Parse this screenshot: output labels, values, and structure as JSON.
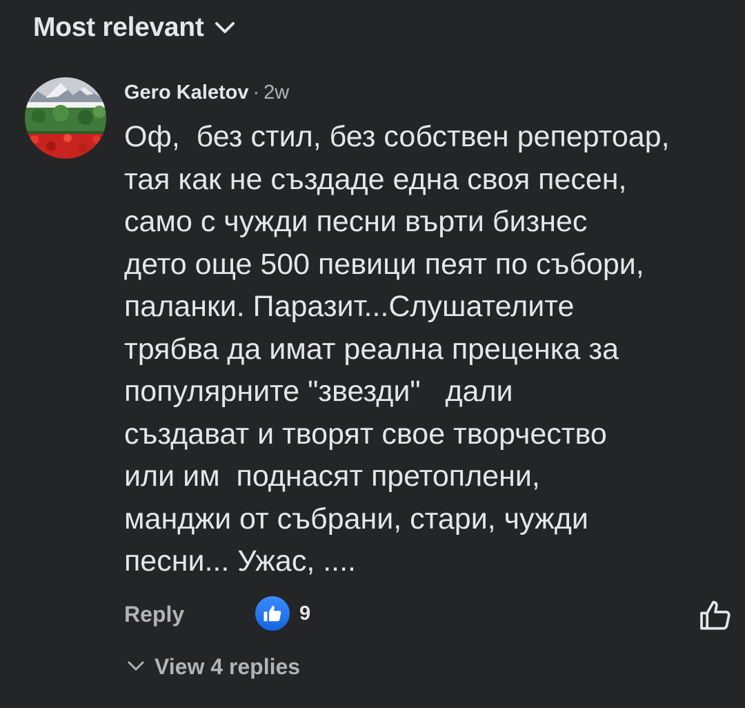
{
  "header": {
    "sort_label": "Most relevant",
    "sort_icon": "chevron-down-icon"
  },
  "comment": {
    "author": "Gero Kaletov",
    "separator": "·",
    "time": "2w",
    "text": "Оф,  без стил, без собствен репертоар,\nтая как не създаде една своя песен,\nсамо с чужди песни върти бизнес\nдето още 500 певици пеят по събори,\nпаланки. Паразит...Слушателите\nтрябва да имат реална преценка за\nпопулярните \"звезди\"   дали\nсъздават и творят свое творчество\nили им  поднасят претоплени,\nманджи от събрани, стари, чужди\nпесни... Ужас, ....",
    "avatar_icon": "profile-photo-bulgarian-flag-landscape"
  },
  "actions": {
    "reply_label": "Reply",
    "reaction_icon": "like-reaction-icon",
    "reaction_count": "9",
    "like_icon": "thumbs-up-outline-icon"
  },
  "replies": {
    "label": "View 4 replies",
    "icon": "chevron-down-icon"
  },
  "colors": {
    "background": "#242526",
    "primary_text": "#e4e6eb",
    "secondary_text": "#b0b3b8",
    "like_blue": "#1877f2"
  }
}
